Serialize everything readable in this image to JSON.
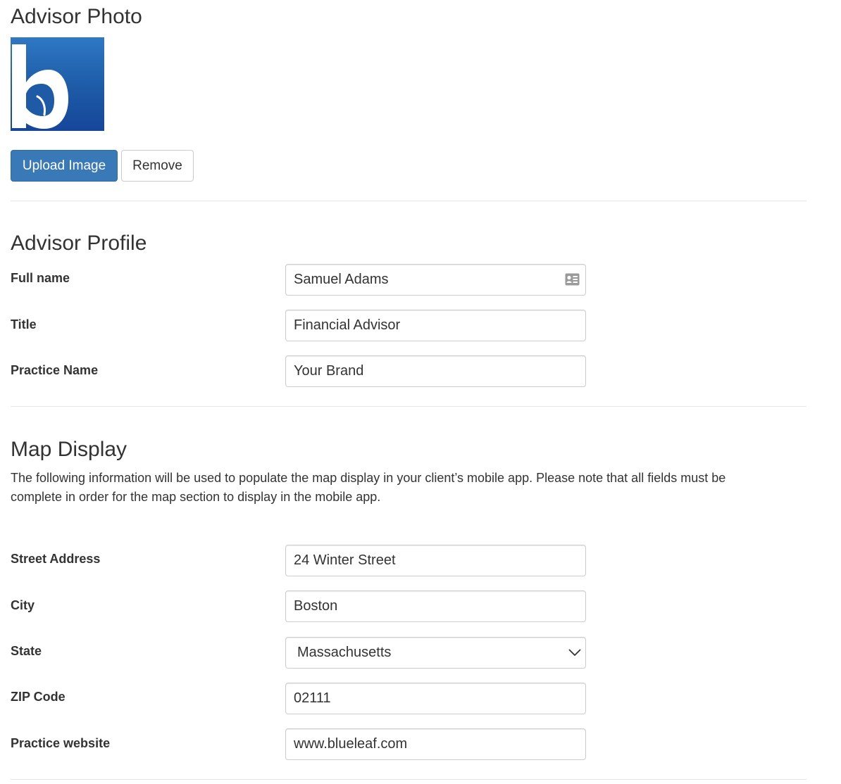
{
  "photo_section": {
    "title": "Advisor Photo",
    "upload_label": "Upload Image",
    "remove_label": "Remove",
    "logo_color": "#1d5aa6"
  },
  "profile_section": {
    "title": "Advisor Profile",
    "fields": [
      {
        "label": "Full name",
        "value": "Samuel Adams",
        "icon": "contact-card-icon"
      },
      {
        "label": "Title",
        "value": "Financial Advisor"
      },
      {
        "label": "Practice Name",
        "value": "Your Brand"
      }
    ]
  },
  "map_section": {
    "title": "Map Display",
    "description": "The following information will be used to populate the map display in your client’s mobile app. Please note that all fields must be complete in order for the map section to display in the mobile app.",
    "fields": [
      {
        "label": "Street Address",
        "value": "24 Winter Street"
      },
      {
        "label": "City",
        "value": "Boston"
      },
      {
        "label": "State",
        "value": "Massachusetts",
        "type": "select",
        "icon": "chevron-down-icon"
      },
      {
        "label": "ZIP Code",
        "value": "02111"
      },
      {
        "label": "Practice website",
        "value": "www.blueleaf.com"
      }
    ]
  },
  "colors": {
    "primary_button": "#3a79b8",
    "text": "#333333",
    "border": "#cccccc",
    "divider": "#e5e5e5"
  }
}
